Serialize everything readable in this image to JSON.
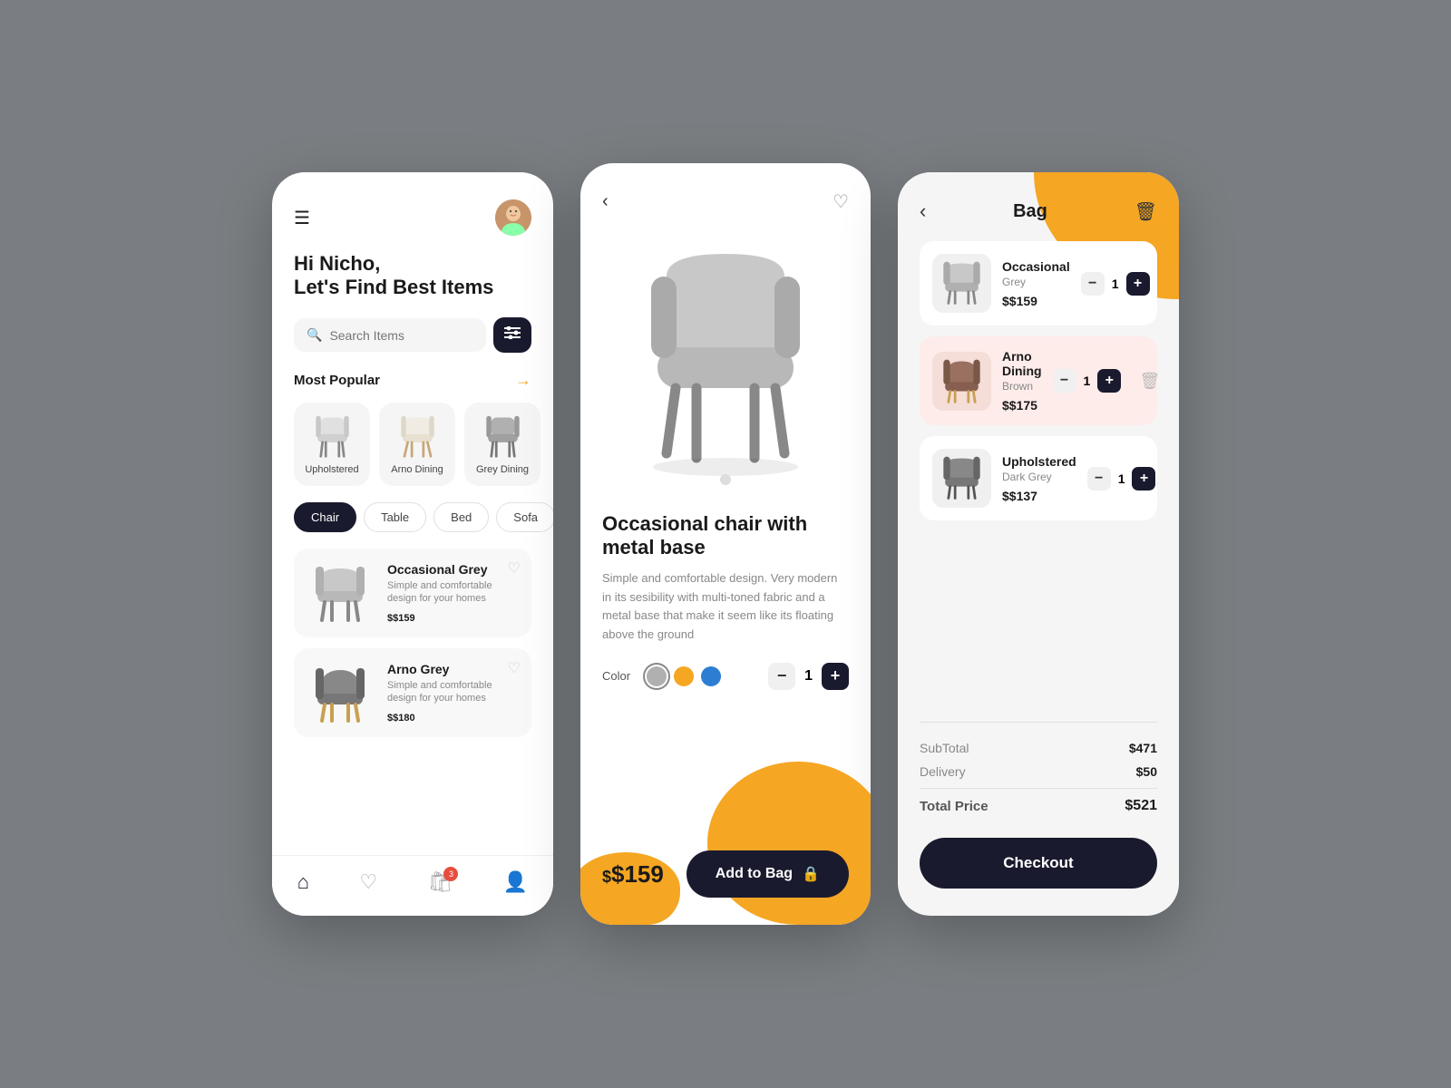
{
  "screen1": {
    "greeting_name": "Hi Nicho,",
    "greeting_sub": "Let's Find Best Items",
    "search_placeholder": "Search Items",
    "filter_icon": "⊞",
    "section_popular": "Most Popular",
    "popular_items": [
      {
        "name": "Upholstered"
      },
      {
        "name": "Arno Dining"
      },
      {
        "name": "Grey Dining"
      }
    ],
    "categories": [
      {
        "label": "Chair",
        "active": true
      },
      {
        "label": "Table",
        "active": false
      },
      {
        "label": "Bed",
        "active": false
      },
      {
        "label": "Sofa",
        "active": false
      }
    ],
    "products": [
      {
        "name": "Occasional Grey",
        "desc": "Simple and comfortable design for your homes",
        "price": "$159"
      },
      {
        "name": "Arno Grey",
        "desc": "Simple and comfortable design for your homes",
        "price": "$180"
      }
    ],
    "nav": [
      {
        "icon": "🏠",
        "active": true,
        "badge": null
      },
      {
        "icon": "♡",
        "active": false,
        "badge": null
      },
      {
        "icon": "🛍",
        "active": false,
        "badge": "3"
      },
      {
        "icon": "👤",
        "active": false,
        "badge": null
      }
    ]
  },
  "screen2": {
    "product_title": "Occasional chair with metal base",
    "product_description": "Simple and comfortable design. Very modern in its sesibility with multi-toned fabric and a metal base that make it seem like its floating above the ground",
    "color_label": "Color",
    "colors": [
      "#b0b0b0",
      "#f5a623",
      "#2d7dd2"
    ],
    "selected_color": 0,
    "quantity": 1,
    "price": "$159",
    "add_to_bag": "Add to Bag"
  },
  "screen3": {
    "title": "Bag",
    "items": [
      {
        "name": "Occasional",
        "color": "Grey",
        "price": "$159",
        "qty": 1
      },
      {
        "name": "Arno Dining",
        "color": "Brown",
        "price": "$175",
        "qty": 1,
        "highlighted": true
      },
      {
        "name": "Upholstered",
        "color": "Dark Grey",
        "price": "$137",
        "qty": 1
      }
    ],
    "subtotal_label": "SubTotal",
    "subtotal_value": "$471",
    "delivery_label": "Delivery",
    "delivery_value": "$50",
    "total_label": "Total Price",
    "total_value": "$521",
    "checkout_label": "Checkout"
  }
}
